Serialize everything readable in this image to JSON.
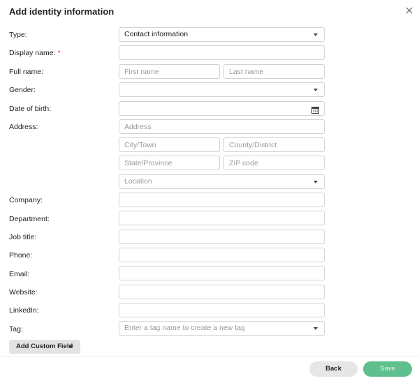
{
  "dialog": {
    "title": "Add identity information",
    "close_icon": "close-icon"
  },
  "labels": {
    "type": "Type:",
    "display_name": "Display name:",
    "required_marker": "*",
    "full_name": "Full name:",
    "gender": "Gender:",
    "date_of_birth": "Date of birth:",
    "address": "Address:",
    "company": "Company:",
    "department": "Department:",
    "job_title": "Job title:",
    "phone": "Phone:",
    "email": "Email:",
    "website": "Website:",
    "linkedin": "LinkedIn:",
    "tag": "Tag:"
  },
  "fields": {
    "type_value": "Contact information",
    "display_name_value": "",
    "first_name_placeholder": "First name",
    "last_name_placeholder": "Last name",
    "gender_value": "",
    "date_of_birth_value": "",
    "address_placeholder": "Address",
    "city_placeholder": "City/Town",
    "county_placeholder": "County/District",
    "state_placeholder": "State/Province",
    "zip_placeholder": "ZIP code",
    "location_placeholder": "Location",
    "company_value": "",
    "department_value": "",
    "job_title_value": "",
    "phone_value": "",
    "email_value": "",
    "website_value": "",
    "linkedin_value": "",
    "tag_placeholder": "Enter a tag name to create a new tag"
  },
  "buttons": {
    "add_custom_field": "Add Custom Field",
    "back": "Back",
    "save": "Save"
  },
  "colors": {
    "required": "#e53935",
    "save_button": "#5fc08d",
    "back_button": "#e6e6e6"
  }
}
